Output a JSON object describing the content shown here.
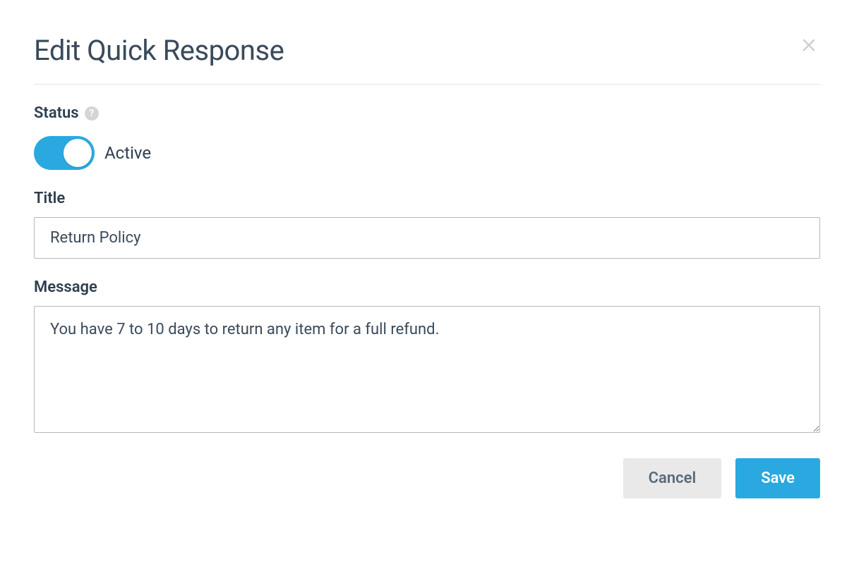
{
  "modal": {
    "title": "Edit Quick Response"
  },
  "status": {
    "label": "Status",
    "toggle_label": "Active",
    "active": true
  },
  "title_field": {
    "label": "Title",
    "value": "Return Policy"
  },
  "message_field": {
    "label": "Message",
    "value": "You have 7 to 10 days to return any item for a full refund."
  },
  "buttons": {
    "cancel": "Cancel",
    "save": "Save"
  }
}
